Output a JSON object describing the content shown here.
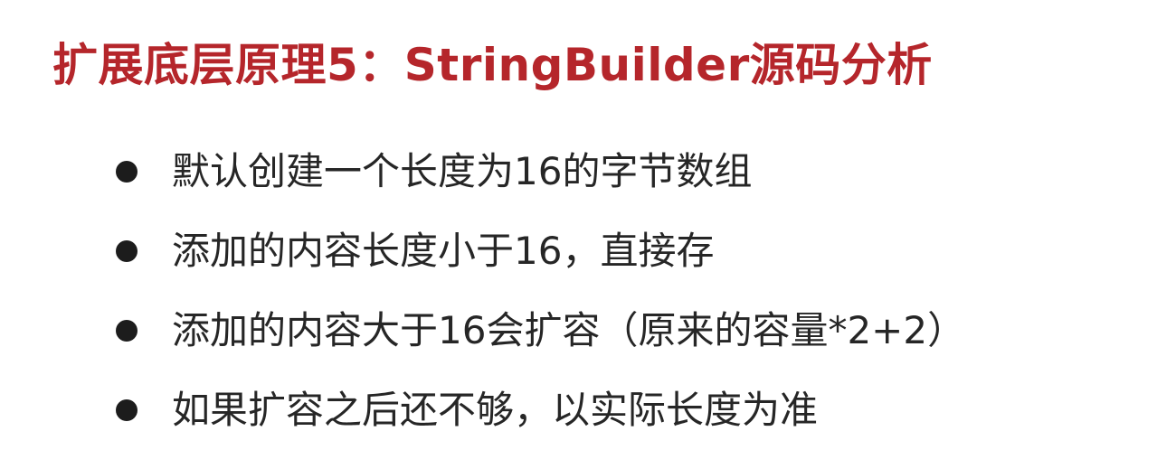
{
  "slide": {
    "title": "扩展底层原理5：StringBuilder源码分析",
    "title_color": "#b5262b",
    "text_color": "#262626",
    "bullet_icon": "filled-circle",
    "bullets": [
      "默认创建一个长度为16的字节数组",
      "添加的内容长度小于16，直接存",
      "添加的内容大于16会扩容（原来的容量*2+2）",
      "如果扩容之后还不够，以实际长度为准"
    ]
  }
}
